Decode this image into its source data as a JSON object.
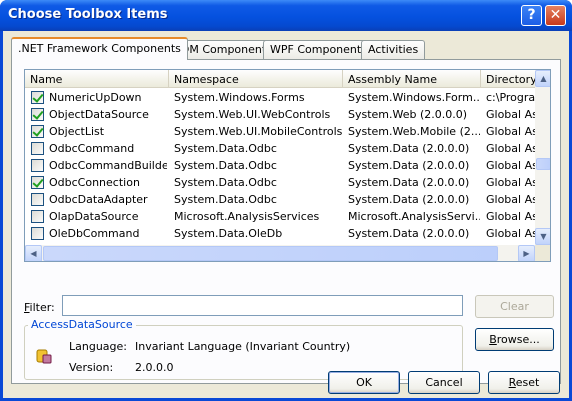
{
  "window": {
    "title": "Choose Toolbox Items",
    "help_glyph": "?",
    "close_glyph": "✕"
  },
  "tabs": [
    {
      "label": ".NET Framework Components",
      "active": true
    },
    {
      "label": "COM Components",
      "active": false
    },
    {
      "label": "WPF Components",
      "active": false
    },
    {
      "label": "Activities",
      "active": false
    }
  ],
  "list": {
    "columns": [
      "Name",
      "Namespace",
      "Assembly Name",
      "Directory"
    ],
    "rows": [
      {
        "checked": true,
        "name": "NumericUpDown",
        "namespace": "System.Windows.Forms",
        "assembly": "System.Windows.Form...",
        "directory": "c:\\Program"
      },
      {
        "checked": true,
        "name": "ObjectDataSource",
        "namespace": "System.Web.UI.WebControls",
        "assembly": "System.Web (2.0.0.0)",
        "directory": "Global Ass"
      },
      {
        "checked": true,
        "name": "ObjectList",
        "namespace": "System.Web.UI.MobileControls",
        "assembly": "System.Web.Mobile (2....",
        "directory": "Global Ass"
      },
      {
        "checked": false,
        "name": "OdbcCommand",
        "namespace": "System.Data.Odbc",
        "assembly": "System.Data (2.0.0.0)",
        "directory": "Global Ass"
      },
      {
        "checked": false,
        "name": "OdbcCommandBuilder",
        "namespace": "System.Data.Odbc",
        "assembly": "System.Data (2.0.0.0)",
        "directory": "Global Ass"
      },
      {
        "checked": true,
        "name": "OdbcConnection",
        "namespace": "System.Data.Odbc",
        "assembly": "System.Data (2.0.0.0)",
        "directory": "Global Ass"
      },
      {
        "checked": false,
        "name": "OdbcDataAdapter",
        "namespace": "System.Data.Odbc",
        "assembly": "System.Data (2.0.0.0)",
        "directory": "Global Ass"
      },
      {
        "checked": false,
        "name": "OlapDataSource",
        "namespace": "Microsoft.AnalysisServices",
        "assembly": "Microsoft.AnalysisServi...",
        "directory": "Global Ass"
      },
      {
        "checked": false,
        "name": "OleDbCommand",
        "namespace": "System.Data.OleDb",
        "assembly": "System.Data (2.0.0.0)",
        "directory": "Global Ass"
      }
    ]
  },
  "filter": {
    "label": "Filter:",
    "value": "",
    "clear_label": "Clear"
  },
  "details": {
    "group_title": "AccessDataSource",
    "language_label": "Language:",
    "language_value": "Invariant Language (Invariant Country)",
    "version_label": "Version:",
    "version_value": "2.0.0.0",
    "icon": "component-package-icon"
  },
  "buttons": {
    "browse": "Browse...",
    "ok": "OK",
    "cancel": "Cancel",
    "reset": "Reset"
  }
}
